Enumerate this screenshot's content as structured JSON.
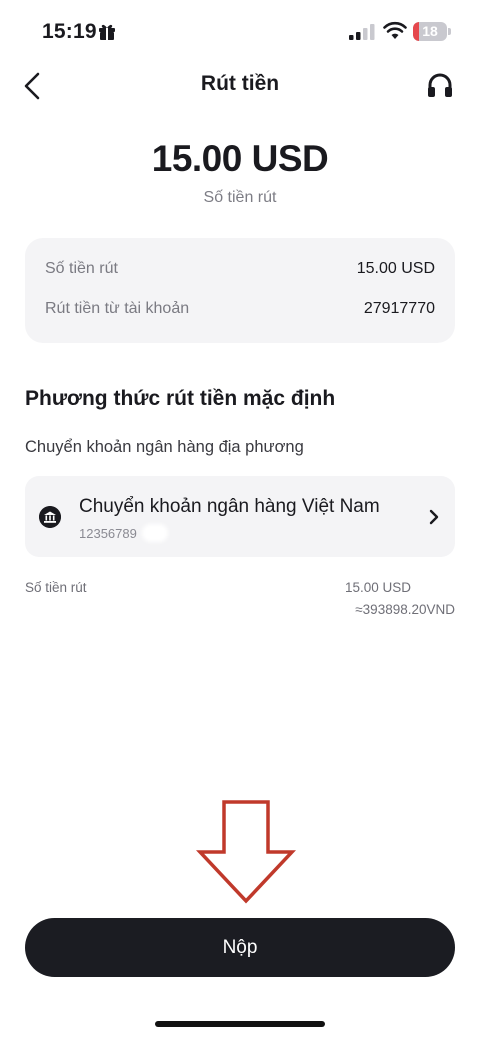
{
  "status_bar": {
    "time": "15:19",
    "battery_level": "18",
    "battery_fraction": 0.18,
    "icons": [
      "gift-icon",
      "signal-icon",
      "wifi-icon",
      "battery-icon"
    ]
  },
  "header": {
    "title": "Rút tiền",
    "back_icon": "chevron-left-icon",
    "support_icon": "headset-icon"
  },
  "amount": {
    "value": "15.00 USD",
    "caption": "Số tiền rút"
  },
  "summary": {
    "rows": [
      {
        "label": "Số tiền rút",
        "value": "15.00 USD"
      },
      {
        "label": "Rút tiền từ tài khoản",
        "value": "27917770"
      }
    ]
  },
  "method_section": {
    "title": "Phương thức rút tiền mặc định",
    "subtitle": "Chuyển khoản ngân hàng địa phương",
    "method": {
      "name": "Chuyển khoản ngân hàng Việt Nam",
      "account": "12356789",
      "icon": "bank-icon"
    }
  },
  "withdraw_amount": {
    "label": "Số tiền rút",
    "usd": "15.00 USD",
    "vnd": "≈393898.20VND"
  },
  "submit": {
    "label": "Nộp"
  },
  "colors": {
    "primary_button": "#1b1c22",
    "card_bg": "#f4f4f6",
    "annotation_arrow": "#c0392b"
  }
}
